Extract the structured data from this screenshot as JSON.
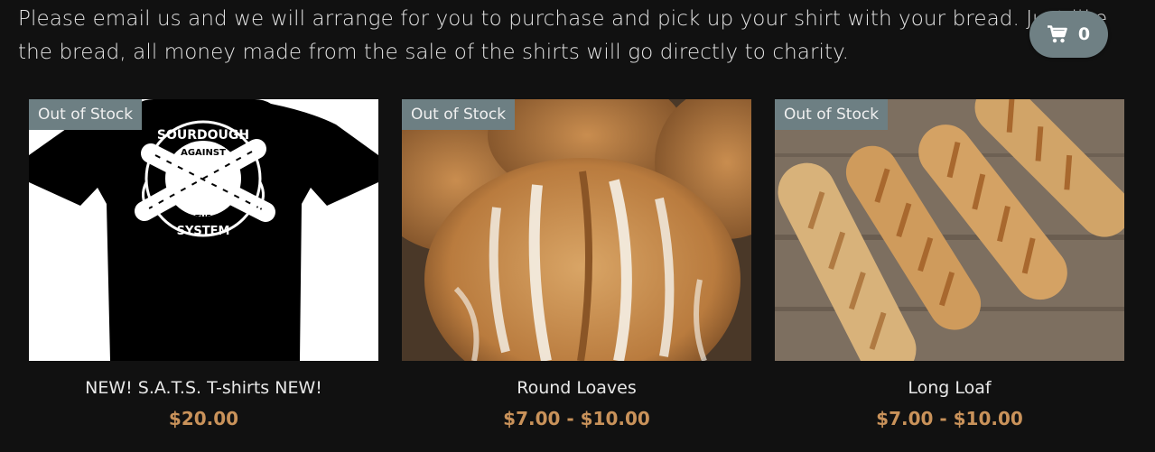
{
  "intro": {
    "text": "Please email us and we will arrange for you to purchase and pick up your shirt with your bread. Just like the bread, all money made from the sale of the shirts will go directly to charity."
  },
  "cart": {
    "count": "0",
    "icon": "cart-icon"
  },
  "colors": {
    "background": "#111111",
    "badge": "#6d7f83",
    "price": "#c9925a",
    "cart_button": "#6f8084"
  },
  "products": [
    {
      "badge": "Out of Stock",
      "name": "NEW! S.A.T.S. T-shirts NEW!",
      "price": "$20.00",
      "shirt_text": {
        "top": "SOURDOUGH",
        "middle": "AGAINST",
        "small": "THE",
        "bottom": "SYSTEM"
      }
    },
    {
      "badge": "Out of Stock",
      "name": "Round Loaves",
      "price": "$7.00 - $10.00"
    },
    {
      "badge": "Out of Stock",
      "name": "Long Loaf",
      "price": "$7.00 - $10.00"
    }
  ]
}
